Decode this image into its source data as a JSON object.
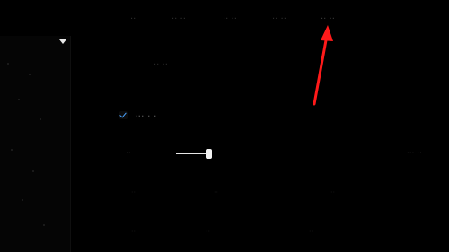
{
  "topnav": {
    "tabs": [
      {
        "label": "··",
        "active": false
      },
      {
        "label": "·· ··",
        "active": false
      },
      {
        "label": "·· ··",
        "active": false
      },
      {
        "label": "·· ··",
        "active": false
      },
      {
        "label": "·· ··",
        "active": true
      }
    ]
  },
  "settings": {
    "section_title": "·· ··",
    "checkbox": {
      "label": "··· · ·",
      "checked": true
    },
    "slider": {
      "label": "··",
      "value_text": "··· ··",
      "level": 0.9
    }
  },
  "faint_rows": [
    {
      "a": "··",
      "b": "··",
      "c": "··"
    },
    {
      "a": "··",
      "b": "··",
      "c": "··"
    }
  ],
  "colors": {
    "accent": "#4aa3ff",
    "arrow": "#ff1a1a",
    "background": "#000000"
  }
}
